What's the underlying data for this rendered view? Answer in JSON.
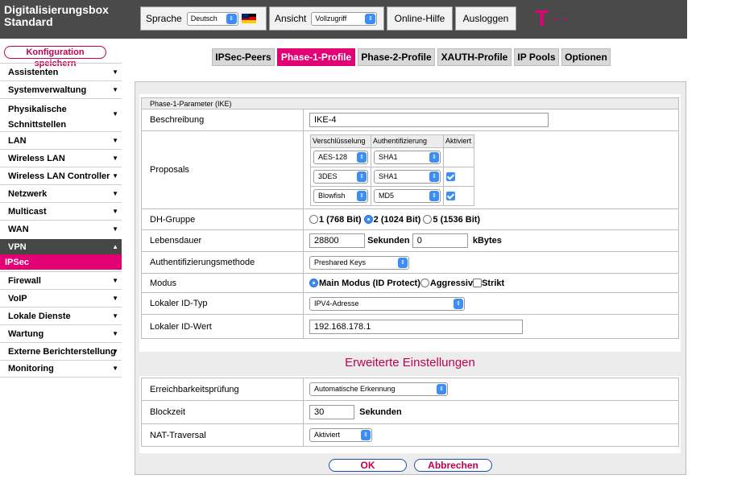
{
  "header": {
    "brand_line1": "Digitalisierungsbox",
    "brand_line2": "Standard",
    "language_label": "Sprache",
    "language_value": "Deutsch",
    "view_label": "Ansicht",
    "view_value": "Vollzugriff",
    "help_label": "Online-Hilfe",
    "logout_label": "Ausloggen",
    "logo_letter": "T",
    "logo_dots": "· ·"
  },
  "sidebar": {
    "save_label": "Konfiguration speichern",
    "items": [
      {
        "label": "Assistenten"
      },
      {
        "label": "Systemverwaltung"
      },
      {
        "label": "Physikalische Schnittstellen"
      },
      {
        "label": "LAN"
      },
      {
        "label": "Wireless LAN"
      },
      {
        "label": "Wireless LAN Controller"
      },
      {
        "label": "Netzwerk"
      },
      {
        "label": "Multicast"
      },
      {
        "label": "WAN"
      },
      {
        "label": "VPN"
      },
      {
        "label": "IPSec"
      },
      {
        "label": "Firewall"
      },
      {
        "label": "VoIP"
      },
      {
        "label": "Lokale Dienste"
      },
      {
        "label": "Wartung"
      },
      {
        "label": "Externe Berichterstellung"
      },
      {
        "label": "Monitoring"
      }
    ]
  },
  "tabs": [
    {
      "label": "IPSec-Peers"
    },
    {
      "label": "Phase-1-Profile"
    },
    {
      "label": "Phase-2-Profile"
    },
    {
      "label": "XAUTH-Profile"
    },
    {
      "label": "IP Pools"
    },
    {
      "label": "Optionen"
    }
  ],
  "form": {
    "section_header": "Phase-1-Parameter (IKE)",
    "description_label": "Beschreibung",
    "description_value": "IKE-4",
    "proposals_label": "Proposals",
    "proposals_headers": [
      "Verschlüsselung",
      "Authentifizierung",
      "Aktiviert"
    ],
    "proposals": [
      {
        "encryption": "AES-128",
        "auth": "SHA1",
        "enabled": false
      },
      {
        "encryption": "3DES",
        "auth": "SHA1",
        "enabled": true
      },
      {
        "encryption": "Blowfish",
        "auth": "MD5",
        "enabled": true
      }
    ],
    "dh_label": "DH-Gruppe",
    "dh_options": [
      "1 (768 Bit)",
      "2 (1024 Bit)",
      "5 (1536 Bit)"
    ],
    "dh_selected": "2 (1024 Bit)",
    "lifetime_label": "Lebensdauer",
    "lifetime_seconds": "28800",
    "lifetime_seconds_unit": "Sekunden",
    "lifetime_kbytes": "0",
    "lifetime_kbytes_unit": "kBytes",
    "auth_method_label": "Authentifizierungsmethode",
    "auth_method_value": "Preshared Keys",
    "mode_label": "Modus",
    "mode_main": "Main Modus (ID Protect)",
    "mode_aggressive": "Aggressiv",
    "mode_strict": "Strikt",
    "local_id_type_label": "Lokaler ID-Typ",
    "local_id_type_value": "IPV4-Adresse",
    "local_id_value_label": "Lokaler ID-Wert",
    "local_id_value": "192.168.178.1"
  },
  "advanced": {
    "title": "Erweiterte Einstellungen",
    "reachability_label": "Erreichbarkeitsprüfung",
    "reachability_value": "Automatische Erkennung",
    "block_time_label": "Blockzeit",
    "block_time_value": "30",
    "block_time_unit": "Sekunden",
    "nat_label": "NAT-Traversal",
    "nat_value": "Aktiviert"
  },
  "footer": {
    "ok_label": "OK",
    "cancel_label": "Abbrechen"
  },
  "colors": {
    "accent": "#e20074",
    "header_bg": "#4a4a4a",
    "select_blue": "#3d8df5"
  }
}
